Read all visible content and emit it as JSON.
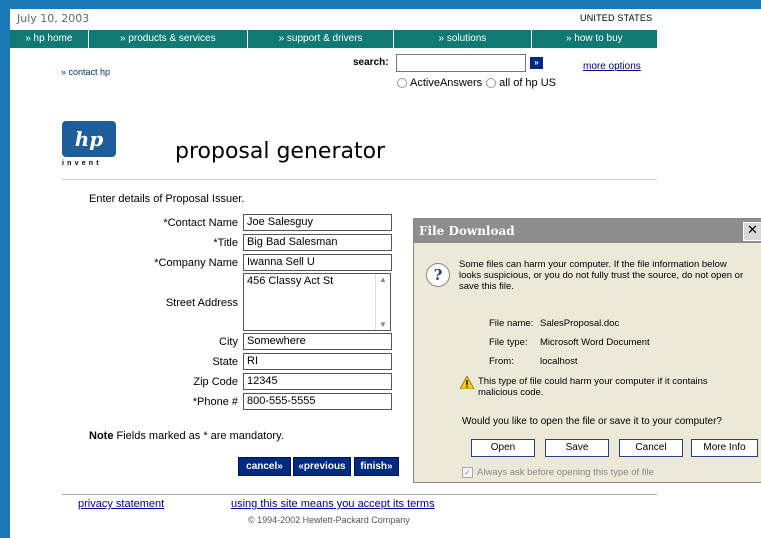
{
  "header": {
    "date": "July 10, 2003",
    "country": "UNITED STATES"
  },
  "nav": {
    "items": [
      {
        "label": "» hp home"
      },
      {
        "label": "» products & services"
      },
      {
        "label": "» support & drivers"
      },
      {
        "label": "» solutions"
      },
      {
        "label": "» how to buy"
      }
    ]
  },
  "contact_link": "» contact hp",
  "search": {
    "label": "search:",
    "value": "",
    "go_label": "»",
    "more_options": "more options",
    "option_1": "ActiveAnswers",
    "option_2": "all of hp US"
  },
  "logo": {
    "mark": "hp",
    "tagline": "invent"
  },
  "page_title": "proposal generator",
  "form": {
    "intro": "Enter details of Proposal Issuer.",
    "fields": {
      "contact_name": {
        "label": "*Contact Name",
        "value": "Joe Salesguy"
      },
      "title": {
        "label": "*Title",
        "value": "Big Bad Salesman"
      },
      "company_name": {
        "label": "*Company Name",
        "value": "Iwanna Sell U"
      },
      "street_address": {
        "label": "Street Address",
        "value": "456 Classy Act St"
      },
      "city": {
        "label": "City",
        "value": "Somewhere"
      },
      "state": {
        "label": "State",
        "value": "RI"
      },
      "zip_code": {
        "label": "Zip Code",
        "value": "12345"
      },
      "phone": {
        "label": "*Phone #",
        "value": "800-555-5555"
      }
    },
    "note_bold": "Note",
    "note_text": " Fields marked as * are mandatory.",
    "buttons": {
      "cancel": "cancel»",
      "previous": "«previous",
      "finish": "finish»"
    }
  },
  "footer": {
    "privacy": "privacy statement",
    "terms": "using this site means you accept its terms",
    "copyright": "© 1994-2002 Hewlett-Packard Company"
  },
  "dialog": {
    "title": "File Download",
    "close": "✕",
    "message": "Some files can harm your computer. If the file information below looks suspicious, or you do not fully trust the source, do not open or save this file.",
    "file_name_label": "File name:",
    "file_name": "SalesProposal.doc",
    "file_type_label": "File type:",
    "file_type": "Microsoft Word Document",
    "from_label": "From:",
    "from": "localhost",
    "warning": "This type of file could harm your computer if it contains malicious code.",
    "question": "Would you like to open the file or save it to your computer?",
    "buttons": {
      "open": "Open",
      "save": "Save",
      "cancel": "Cancel",
      "more_info": "More Info"
    },
    "checkbox_label": "Always ask before opening this type of file",
    "checkbox_checked": true
  },
  "colors": {
    "background": "#1a78b4",
    "nav_bar": "#0f7a74",
    "button_blue": "#002a80"
  },
  "icons": {
    "search_go": "arrow-icon",
    "dialog_question": "question-icon",
    "dialog_warning": "warning-icon",
    "dialog_close": "close-icon"
  }
}
